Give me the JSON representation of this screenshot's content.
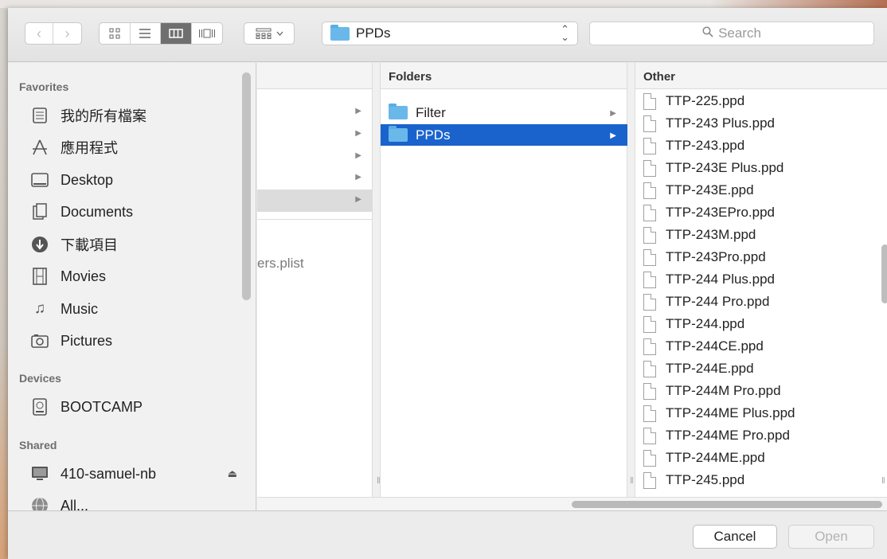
{
  "toolbar": {
    "back_glyph": "‹",
    "forward_glyph": "›",
    "view_icons": [
      "icon-view-icon",
      "list-view-icon",
      "column-view-icon",
      "coverflow-view-icon"
    ],
    "path_label": "PPDs",
    "search_placeholder": "Search"
  },
  "sidebar": {
    "favorites_header": "Favorites",
    "favorites": [
      {
        "label": "我的所有檔案",
        "icon": "all-files-icon"
      },
      {
        "label": "應用程式",
        "icon": "applications-icon"
      },
      {
        "label": "Desktop",
        "icon": "desktop-icon"
      },
      {
        "label": "Documents",
        "icon": "documents-icon"
      },
      {
        "label": "下載項目",
        "icon": "downloads-icon"
      },
      {
        "label": "Movies",
        "icon": "movies-icon"
      },
      {
        "label": "Music",
        "icon": "music-icon"
      },
      {
        "label": "Pictures",
        "icon": "pictures-icon"
      }
    ],
    "devices_header": "Devices",
    "devices": [
      {
        "label": "BOOTCAMP",
        "icon": "disk-icon"
      }
    ],
    "shared_header": "Shared",
    "shared": [
      {
        "label": "410-samuel-nb",
        "icon": "computer-icon"
      },
      {
        "label": "All...",
        "icon": "network-icon"
      }
    ]
  },
  "columns": {
    "col1_partial_text": "ers.plist",
    "col2": {
      "header": "Folders",
      "items": [
        {
          "name": "Filter",
          "selected": false
        },
        {
          "name": "PPDs",
          "selected": true
        }
      ]
    },
    "col3": {
      "header": "Other",
      "files": [
        "TTP-225.ppd",
        "TTP-243 Plus.ppd",
        "TTP-243.ppd",
        "TTP-243E Plus.ppd",
        "TTP-243E.ppd",
        "TTP-243EPro.ppd",
        "TTP-243M.ppd",
        "TTP-243Pro.ppd",
        "TTP-244 Plus.ppd",
        "TTP-244 Pro.ppd",
        "TTP-244.ppd",
        "TTP-244CE.ppd",
        "TTP-244E.ppd",
        "TTP-244M Pro.ppd",
        "TTP-244ME Plus.ppd",
        "TTP-244ME Pro.ppd",
        "TTP-244ME.ppd",
        "TTP-245.ppd"
      ]
    }
  },
  "footer": {
    "cancel_label": "Cancel",
    "open_label": "Open"
  },
  "colors": {
    "selection": "#1a63cc",
    "folder": "#6ab8ea"
  }
}
